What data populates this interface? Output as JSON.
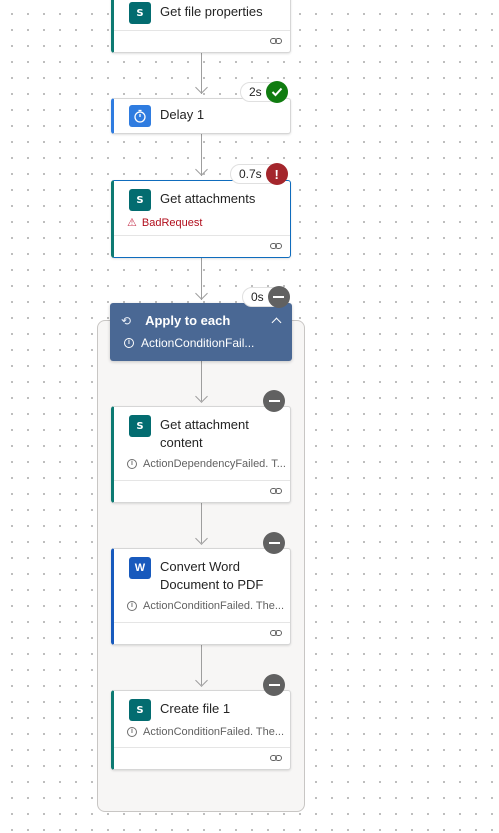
{
  "flow": {
    "get_file_properties": {
      "title": "Get file properties"
    },
    "delay": {
      "title": "Delay 1",
      "duration": "2s"
    },
    "get_attachments": {
      "title": "Get attachments",
      "duration": "0.7s",
      "status": "BadRequest"
    },
    "apply_to_each": {
      "title": "Apply to each",
      "duration": "0s",
      "status": "ActionConditionFail..."
    },
    "get_attachment_content": {
      "title": "Get attachment content",
      "status": "ActionDependencyFailed. T..."
    },
    "convert_word": {
      "title": "Convert Word Document to PDF",
      "status": "ActionConditionFailed. The..."
    },
    "create_file": {
      "title": "Create file 1",
      "status": "ActionConditionFailed. The..."
    }
  },
  "icons": {
    "sharepoint": "sharepoint-icon",
    "word": "word-icon",
    "delay": "timer-icon",
    "loop": "loop-icon",
    "info": "info-icon",
    "warning": "warning-icon",
    "link": "link-icon",
    "success": "check-icon",
    "failed": "exclamation-icon",
    "skipped": "minus-icon"
  },
  "colors": {
    "sharepoint": "#036c70",
    "word": "#185abd",
    "scope_header": "#4a6894",
    "success": "#107c10",
    "failed": "#a4262c",
    "skipped": "#616161",
    "error_text": "#b10e1c"
  }
}
